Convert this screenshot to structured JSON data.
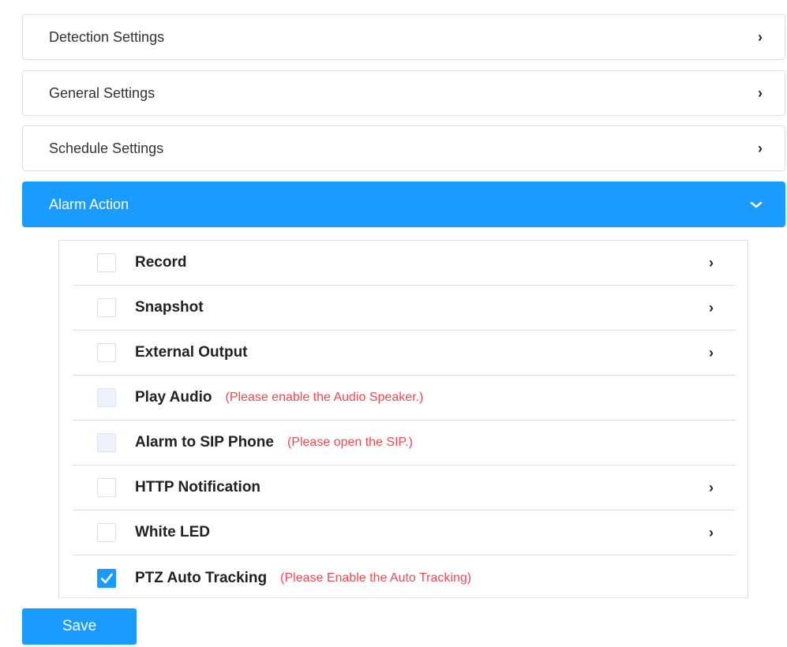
{
  "panels": [
    {
      "label": "Detection Settings",
      "chevron": "›"
    },
    {
      "label": "General Settings",
      "chevron": "›"
    },
    {
      "label": "Schedule Settings",
      "chevron": "›"
    },
    {
      "label": "Alarm Action",
      "chevron": "⌄"
    }
  ],
  "alarm_actions": [
    {
      "label": "Record",
      "checked": false,
      "disabled": false,
      "hint": "",
      "chevron": "›"
    },
    {
      "label": "Snapshot",
      "checked": false,
      "disabled": false,
      "hint": "",
      "chevron": "›"
    },
    {
      "label": "External Output",
      "checked": false,
      "disabled": false,
      "hint": "",
      "chevron": "›"
    },
    {
      "label": "Play Audio",
      "checked": false,
      "disabled": true,
      "hint": "(Please enable the Audio Speaker.)",
      "chevron": ""
    },
    {
      "label": "Alarm to SIP Phone",
      "checked": false,
      "disabled": true,
      "hint": "(Please open the SIP.)",
      "chevron": ""
    },
    {
      "label": "HTTP Notification",
      "checked": false,
      "disabled": false,
      "hint": "",
      "chevron": "›"
    },
    {
      "label": "White LED",
      "checked": false,
      "disabled": false,
      "hint": "",
      "chevron": "›"
    },
    {
      "label": "PTZ Auto Tracking",
      "checked": true,
      "disabled": false,
      "hint": "(Please Enable the Auto Tracking)",
      "chevron": ""
    }
  ],
  "save_label": "Save",
  "colors": {
    "accent": "#1a9bff",
    "hint": "#f5474f"
  }
}
